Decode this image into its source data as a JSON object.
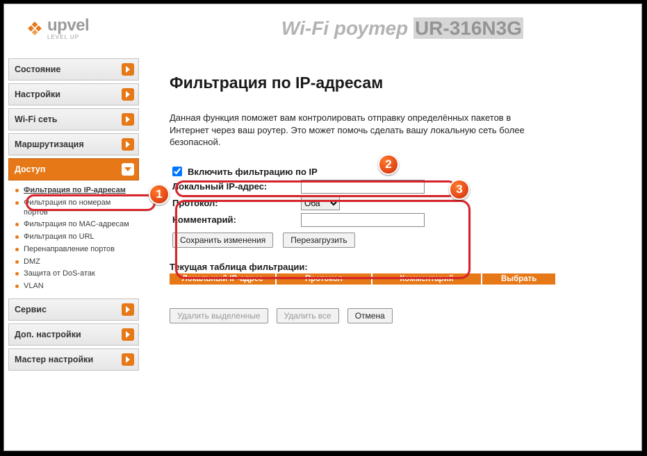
{
  "brand": {
    "name": "upvel",
    "tagline": "LEVEL UP"
  },
  "header": {
    "title_prefix": "Wi-Fi роутер ",
    "model": "UR-316N3G"
  },
  "sidebar": {
    "items": [
      {
        "label": "Состояние"
      },
      {
        "label": "Настройки"
      },
      {
        "label": "Wi-Fi сеть"
      },
      {
        "label": "Маршрутизация"
      },
      {
        "label": "Доступ",
        "active": true
      },
      {
        "label": "Сервис"
      },
      {
        "label": "Доп. настройки"
      },
      {
        "label": "Мастер настройки"
      }
    ],
    "submenu": [
      {
        "label": "Фильтрация по IP-адресам",
        "active": true
      },
      {
        "label": "Фильтрация по номерам портов"
      },
      {
        "label": "Фильтрация по MAC-адресам"
      },
      {
        "label": "Фильтрация по URL"
      },
      {
        "label": "Перенаправление портов"
      },
      {
        "label": "DMZ"
      },
      {
        "label": "Защита от DoS-атак"
      },
      {
        "label": "VLAN"
      }
    ]
  },
  "page": {
    "title": "Фильтрация по IP-адресам",
    "intro": "Данная функция поможет вам контролировать отправку определённых пакетов в Интернет через ваш роутер. Это может помочь сделать вашу локальную сеть более безопасной.",
    "enable_label": "Включить фильтрацию по IP",
    "enable_checked": true,
    "rows": {
      "local_ip": {
        "label": "Локальный IP-адрес:",
        "value": ""
      },
      "protocol": {
        "label": "Протокол:",
        "value": "Оба",
        "options": [
          "Оба"
        ]
      },
      "comment": {
        "label": "Комментарий:",
        "value": ""
      }
    },
    "buttons": {
      "save": "Сохранить изменения",
      "reload": "Перезагрузить"
    },
    "table": {
      "caption": "Текущая таблица фильтрации:",
      "headers": [
        "Локальный IP-адрес",
        "Протокол",
        "Комментарий",
        "Выбрать"
      ]
    },
    "footer_buttons": {
      "del_selected": "Удалить выделенные",
      "del_all": "Удалить все",
      "cancel": "Отмена"
    }
  },
  "annotations": {
    "n1": "1",
    "n2": "2",
    "n3": "3"
  }
}
